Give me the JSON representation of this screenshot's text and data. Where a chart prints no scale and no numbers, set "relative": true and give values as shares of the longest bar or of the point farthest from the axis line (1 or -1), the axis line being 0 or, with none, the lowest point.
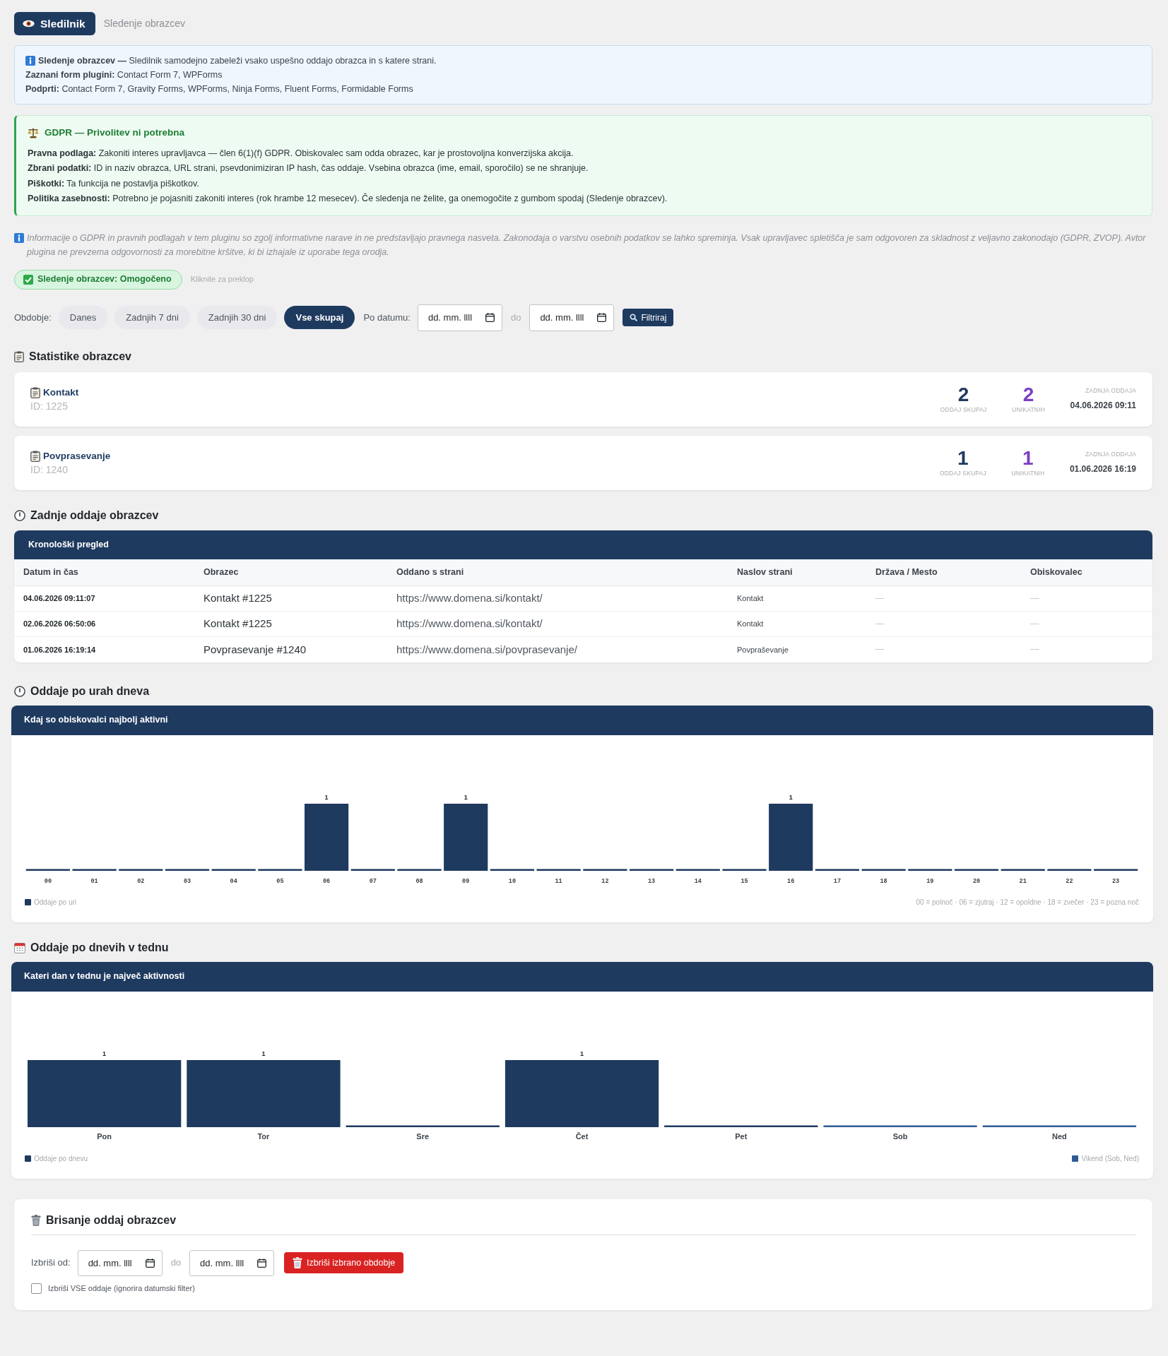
{
  "header": {
    "brand": "Sledilnik",
    "subtitle": "Sledenje obrazcev"
  },
  "info_notice": {
    "lines": [
      "**Sledenje obrazcev —** Sledilnik samodejno zabeleži vsako uspešno oddajo obrazca in s katere strani.",
      "**Zaznani form plugini:** Contact Form 7, WPForms",
      "**Podprti:** Contact Form 7, Gravity Forms, WPForms, Ninja Forms, Fluent Forms, Formidable Forms"
    ]
  },
  "gdpr_notice": {
    "title": "GDPR — Privolitev ni potrebna",
    "lines": [
      "**Pravna podlaga:** Zakoniti interes upravljavca — člen 6(1)(f) GDPR. Obiskovalec sam odda obrazec, kar je prostovoljna konverzijska akcija.",
      "**Zbrani podatki:** ID in naziv obrazca, URL strani, psevdonimiziran IP hash, čas oddaje. Vsebina obrazca (ime, email, sporočilo) se ne shranjuje.",
      "**Piškotki:** Ta funkcija ne postavlja piškotkov.",
      "**Politika zasebnosti:** Potrebno je pojasniti zakoniti interes (rok hrambe 12 mesecev). Če sledenja ne želite, ga onemogočite z gumbom spodaj (Sledenje obrazcev)."
    ]
  },
  "disclaimer": "Informacije o GDPR in pravnih podlagah v tem pluginu so zgolj informativne narave in ne predstavljajo pravnega nasveta. Zakonodaja o varstvu osebnih podatkov se lahko spreminja. Vsak upravljavec spletišča je sam odgovoren za skladnost z veljavno zakonodajo (GDPR, ZVOP). Avtor plugina ne prevzema odgovornosti za morebitne kršitve, ki bi izhajale iz uporabe tega orodja.",
  "tracking_toggle": {
    "label": "Sledenje obrazcev: Omogočeno",
    "on": true,
    "hint": "Kliknite za preklop"
  },
  "filters": {
    "label": "Obdobje:",
    "periods": [
      {
        "label": "Danes",
        "selected": false
      },
      {
        "label": "Zadnjih 7 dni",
        "selected": false
      },
      {
        "label": "Zadnjih 30 dni",
        "selected": false
      },
      {
        "label": "Vse skupaj",
        "selected": true
      }
    ],
    "date_label": "Po datumu:",
    "date_from": {
      "placeholder": "dd. mm. llll"
    },
    "separator": "do",
    "date_to": {
      "placeholder": "dd. mm. llll"
    },
    "button": "Filtriraj"
  },
  "form_stats": {
    "title": "Statistike obrazcev",
    "forms": [
      {
        "name": "Kontakt",
        "id": "ID: 1225",
        "total": "2",
        "total_label": "ODDAJ SKUPAJ",
        "unique": "2",
        "unique_label": "UNIKATNIH",
        "last_label": "ZADNJA ODDAJA",
        "last": "04.06.2026 09:11"
      },
      {
        "name": "Povprasevanje",
        "id": "ID: 1240",
        "total": "1",
        "total_label": "ODDAJ SKUPAJ",
        "unique": "1",
        "unique_label": "UNIKATNIH",
        "last_label": "ZADNJA ODDAJA",
        "last": "01.06.2026 16:19"
      }
    ]
  },
  "recent_submissions": {
    "title": "Zadnje oddaje obrazcev",
    "card_title": "Kronološki pregled",
    "table": {
      "columns": [
        "Datum in čas",
        "Obrazec",
        "Oddano s strani",
        "Naslov strani",
        "Država / Mesto",
        "Obiskovalec"
      ],
      "rows": [
        [
          "04.06.2026 09:11:07",
          "Kontakt #1225",
          "https://www.domena.si/kontakt/",
          "Kontakt",
          "—",
          "—"
        ],
        [
          "02.06.2026 06:50:06",
          "Kontakt #1225",
          "https://www.domena.si/kontakt/",
          "Kontakt",
          "—",
          "—"
        ],
        [
          "01.06.2026 16:19:14",
          "Povprasevanje #1240",
          "https://www.domena.si/povprasevanje/",
          "Povpraševanje",
          "—",
          "—"
        ]
      ]
    }
  },
  "hourly": {
    "title": "Oddaje po urah dneva",
    "card_title": "Kdaj so obiskovalci najbolj aktivni",
    "chart_data": {
      "type": "bar",
      "categories": [
        "00",
        "01",
        "02",
        "03",
        "04",
        "05",
        "06",
        "07",
        "08",
        "09",
        "10",
        "11",
        "12",
        "13",
        "14",
        "15",
        "16",
        "17",
        "18",
        "19",
        "20",
        "21",
        "22",
        "23"
      ],
      "series": [
        {
          "name": "Oddaje po uri",
          "color": "#1e3a5f",
          "values": [
            0,
            0,
            0,
            0,
            0,
            0,
            1,
            0,
            0,
            1,
            0,
            0,
            0,
            0,
            0,
            0,
            1,
            0,
            0,
            0,
            0,
            0,
            0,
            0
          ]
        }
      ],
      "value_labels": [
        null,
        null,
        null,
        null,
        null,
        null,
        "1",
        null,
        null,
        "1",
        null,
        null,
        null,
        null,
        null,
        null,
        "1",
        null,
        null,
        null,
        null,
        null,
        null,
        null
      ],
      "relative": true
    },
    "note": "00 = polnoč · 06 = zjutraj · 12 = opoldne · 18 = zvečer · 23 = pozna noč"
  },
  "weekly": {
    "title": "Oddaje po dnevih v tednu",
    "card_title": "Kateri dan v tednu je največ aktivnosti",
    "chart_data": {
      "type": "bar",
      "categories": [
        "Pon",
        "Tor",
        "Sre",
        "Čet",
        "Pet",
        "Sob",
        "Ned"
      ],
      "series": [
        {
          "name": "Oddaje po dnevu",
          "color": "#1e3a5f",
          "values": [
            1,
            1,
            0,
            1,
            0,
            null,
            null
          ]
        },
        {
          "name": "Vikend (Sob, Ned)",
          "color": "#2d5b94",
          "values": [
            null,
            null,
            null,
            null,
            null,
            0,
            0
          ]
        }
      ],
      "value_labels": [
        "1",
        "1",
        null,
        "1",
        null,
        null,
        null
      ],
      "relative": true
    }
  },
  "delete": {
    "title": "Brisanje oddaj obrazcev",
    "from_label": "Izbriši od:",
    "date_from": {
      "placeholder": "dd. mm. llll"
    },
    "separator": "do",
    "date_to": {
      "placeholder": "dd. mm. llll"
    },
    "button": "Izbriši izbrano obdobje",
    "delete_all": {
      "label": "Izbriši VSE oddaje (ignorira datumski filter)",
      "checked": false
    }
  }
}
